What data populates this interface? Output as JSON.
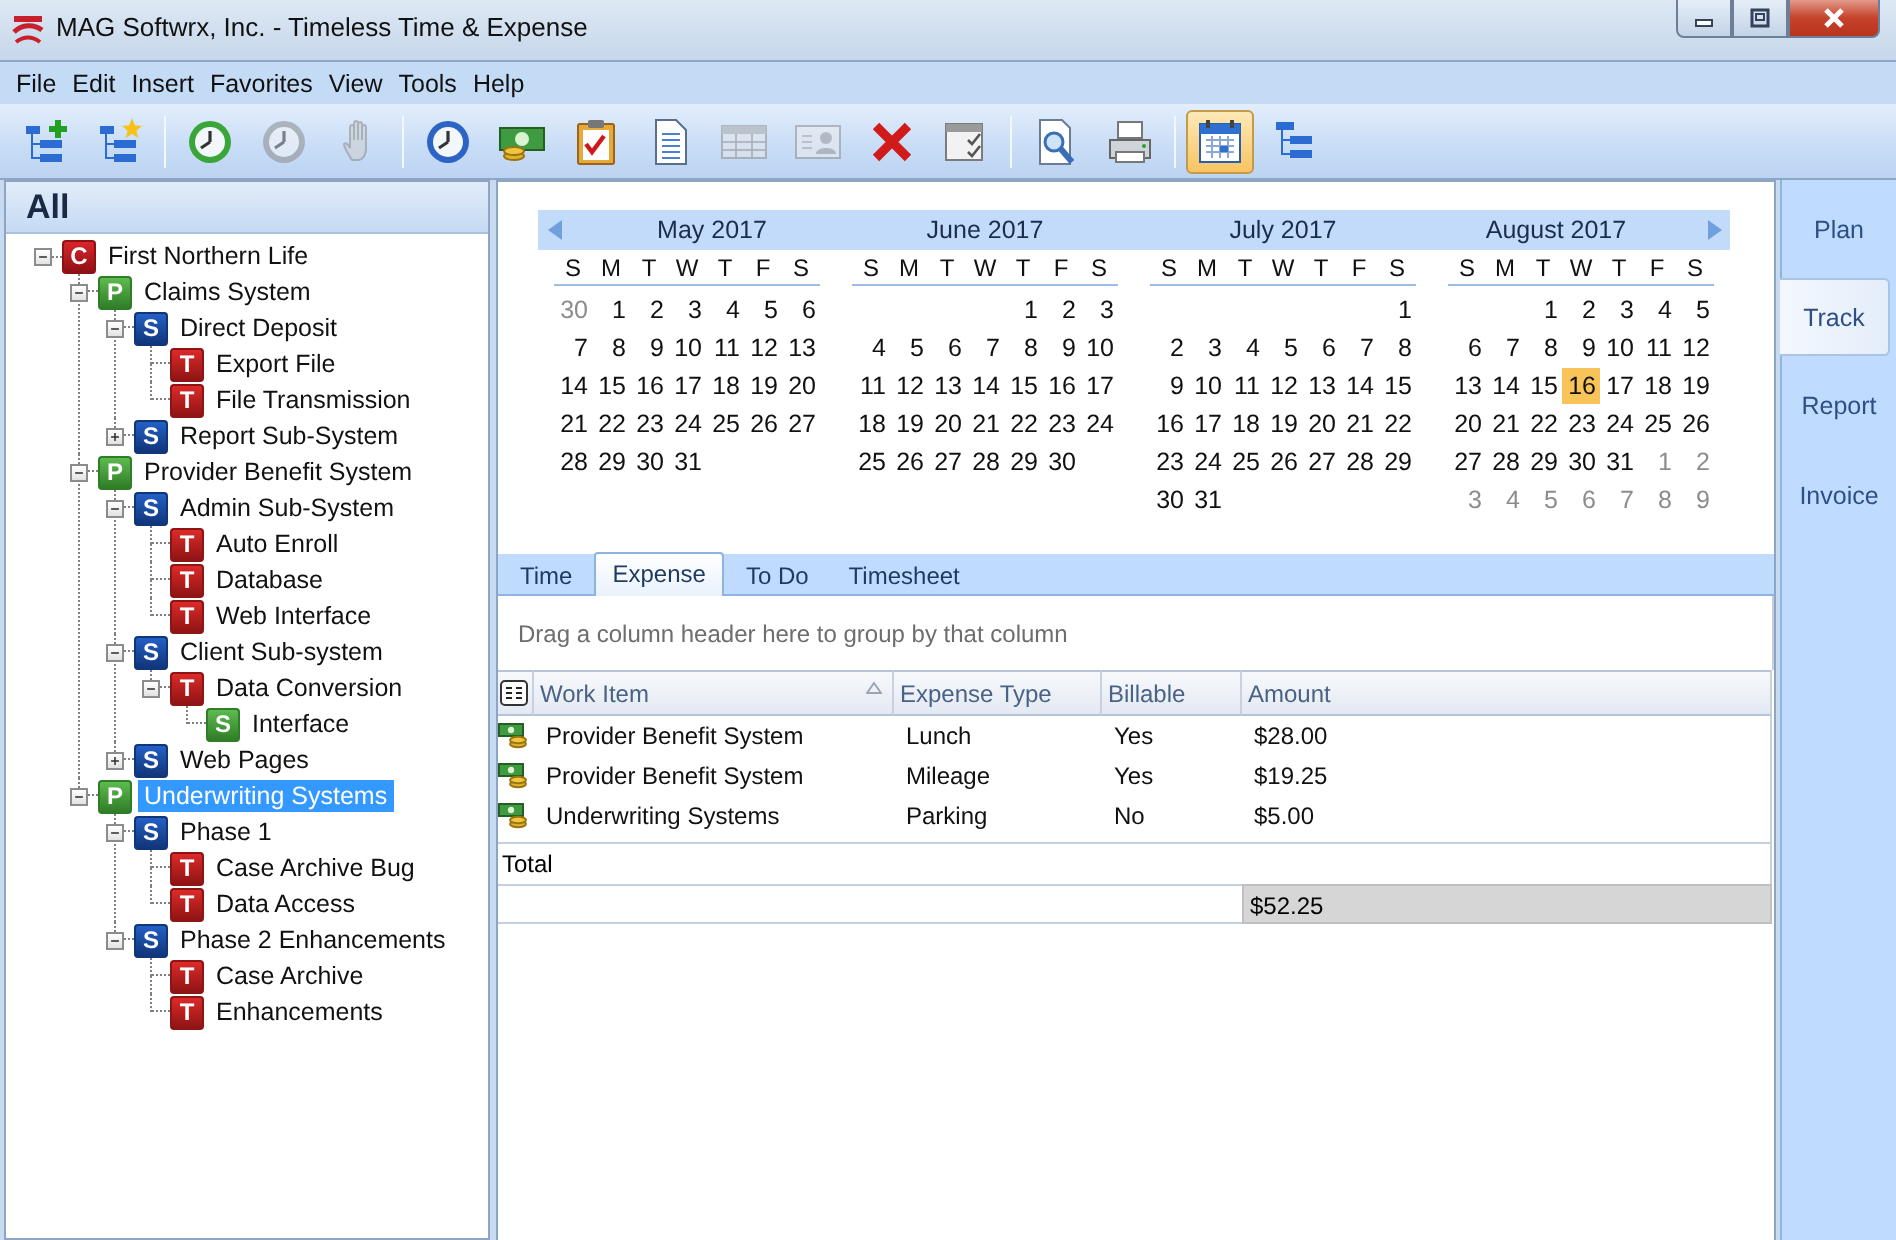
{
  "window": {
    "title": "MAG Softwrx, Inc. - Timeless Time & Expense"
  },
  "menu": [
    "File",
    "Edit",
    "Insert",
    "Favorites",
    "View",
    "Tools",
    "Help"
  ],
  "toolbar": [
    {
      "kind": "button",
      "disabled": false,
      "selected": false
    },
    {
      "kind": "button",
      "disabled": false,
      "selected": false
    },
    {
      "kind": "separator"
    },
    {
      "kind": "button",
      "disabled": false,
      "selected": false
    },
    {
      "kind": "button",
      "disabled": true,
      "selected": false
    },
    {
      "kind": "button",
      "disabled": true,
      "selected": false
    },
    {
      "kind": "separator"
    },
    {
      "kind": "button",
      "disabled": false,
      "selected": false
    },
    {
      "kind": "button",
      "disabled": false,
      "selected": false
    },
    {
      "kind": "button",
      "disabled": false,
      "selected": false
    },
    {
      "kind": "button",
      "disabled": false,
      "selected": false
    },
    {
      "kind": "button",
      "disabled": true,
      "selected": false
    },
    {
      "kind": "button",
      "disabled": true,
      "selected": false
    },
    {
      "kind": "button",
      "disabled": false,
      "selected": false
    },
    {
      "kind": "button",
      "disabled": false,
      "selected": false
    },
    {
      "kind": "separator"
    },
    {
      "kind": "button",
      "disabled": false,
      "selected": false
    },
    {
      "kind": "button",
      "disabled": false,
      "selected": false
    },
    {
      "kind": "separator"
    },
    {
      "kind": "button",
      "disabled": false,
      "selected": true
    },
    {
      "kind": "button",
      "disabled": false,
      "selected": false
    }
  ],
  "tree": {
    "header": "All",
    "nodes": [
      {
        "label": "First Northern Life",
        "badge": "C",
        "kind": "client",
        "expanded": true,
        "selected": false,
        "children": [
          {
            "label": "Claims System",
            "badge": "P",
            "kind": "project",
            "expanded": true,
            "selected": false,
            "children": [
              {
                "label": "Direct Deposit",
                "badge": "S",
                "kind": "system",
                "expanded": true,
                "selected": false,
                "children": [
                  {
                    "label": "Export File",
                    "badge": "T",
                    "kind": "task",
                    "selected": false
                  },
                  {
                    "label": "File Transmission",
                    "badge": "T",
                    "kind": "task",
                    "selected": false
                  }
                ]
              },
              {
                "label": "Report Sub-System",
                "badge": "S",
                "kind": "system",
                "expanded": false,
                "selected": false
              }
            ]
          },
          {
            "label": "Provider Benefit System",
            "badge": "P",
            "kind": "project",
            "expanded": true,
            "selected": false,
            "children": [
              {
                "label": "Admin Sub-System",
                "badge": "S",
                "kind": "system",
                "expanded": true,
                "selected": false,
                "children": [
                  {
                    "label": "Auto Enroll",
                    "badge": "T",
                    "kind": "task",
                    "selected": false
                  },
                  {
                    "label": "Database",
                    "badge": "T",
                    "kind": "task",
                    "selected": false
                  },
                  {
                    "label": "Web Interface",
                    "badge": "T",
                    "kind": "task",
                    "selected": false
                  }
                ]
              },
              {
                "label": "Client Sub-system",
                "badge": "S",
                "kind": "system",
                "expanded": true,
                "selected": false,
                "children": [
                  {
                    "label": "Data Conversion",
                    "badge": "T",
                    "kind": "task",
                    "expanded": true,
                    "selected": false,
                    "children": [
                      {
                        "label": "Interface",
                        "badge": "S",
                        "kind": "module",
                        "selected": false
                      }
                    ]
                  }
                ]
              },
              {
                "label": "Web Pages",
                "badge": "S",
                "kind": "system",
                "expanded": false,
                "selected": false
              }
            ]
          },
          {
            "label": "Underwriting Systems",
            "badge": "P",
            "kind": "project",
            "expanded": true,
            "selected": true,
            "children": [
              {
                "label": "Phase 1",
                "badge": "S",
                "kind": "system",
                "expanded": true,
                "selected": false,
                "children": [
                  {
                    "label": "Case Archive Bug",
                    "badge": "T",
                    "kind": "task",
                    "selected": false
                  },
                  {
                    "label": "Data Access",
                    "badge": "T",
                    "kind": "task",
                    "selected": false
                  }
                ]
              },
              {
                "label": "Phase 2 Enhancements",
                "badge": "S",
                "kind": "system",
                "expanded": true,
                "selected": false,
                "children": [
                  {
                    "label": "Case Archive",
                    "badge": "T",
                    "kind": "task",
                    "selected": false
                  },
                  {
                    "label": "Enhancements",
                    "badge": "T",
                    "kind": "task",
                    "selected": false
                  }
                ]
              }
            ]
          }
        ]
      }
    ]
  },
  "calendar": {
    "months": [
      {
        "title": "May 2017",
        "weekdays": [
          "S",
          "M",
          "T",
          "W",
          "T",
          "F",
          "S"
        ],
        "weeks": [
          [
            {
              "day": "30",
              "outside": true,
              "selected": false
            },
            {
              "day": "1",
              "outside": false,
              "selected": false
            },
            {
              "day": "2",
              "outside": false,
              "selected": false
            },
            {
              "day": "3",
              "outside": false,
              "selected": false
            },
            {
              "day": "4",
              "outside": false,
              "selected": false
            },
            {
              "day": "5",
              "outside": false,
              "selected": false
            },
            {
              "day": "6",
              "outside": false,
              "selected": false
            }
          ],
          [
            {
              "day": "7",
              "outside": false,
              "selected": false
            },
            {
              "day": "8",
              "outside": false,
              "selected": false
            },
            {
              "day": "9",
              "outside": false,
              "selected": false
            },
            {
              "day": "10",
              "outside": false,
              "selected": false
            },
            {
              "day": "11",
              "outside": false,
              "selected": false
            },
            {
              "day": "12",
              "outside": false,
              "selected": false
            },
            {
              "day": "13",
              "outside": false,
              "selected": false
            }
          ],
          [
            {
              "day": "14",
              "outside": false,
              "selected": false
            },
            {
              "day": "15",
              "outside": false,
              "selected": false
            },
            {
              "day": "16",
              "outside": false,
              "selected": false
            },
            {
              "day": "17",
              "outside": false,
              "selected": false
            },
            {
              "day": "18",
              "outside": false,
              "selected": false
            },
            {
              "day": "19",
              "outside": false,
              "selected": false
            },
            {
              "day": "20",
              "outside": false,
              "selected": false
            }
          ],
          [
            {
              "day": "21",
              "outside": false,
              "selected": false
            },
            {
              "day": "22",
              "outside": false,
              "selected": false
            },
            {
              "day": "23",
              "outside": false,
              "selected": false
            },
            {
              "day": "24",
              "outside": false,
              "selected": false
            },
            {
              "day": "25",
              "outside": false,
              "selected": false
            },
            {
              "day": "26",
              "outside": false,
              "selected": false
            },
            {
              "day": "27",
              "outside": false,
              "selected": false
            }
          ],
          [
            {
              "day": "28",
              "outside": false,
              "selected": false
            },
            {
              "day": "29",
              "outside": false,
              "selected": false
            },
            {
              "day": "30",
              "outside": false,
              "selected": false
            },
            {
              "day": "31",
              "outside": false,
              "selected": false
            }
          ]
        ]
      },
      {
        "title": "June 2017",
        "weekdays": [
          "S",
          "M",
          "T",
          "W",
          "T",
          "F",
          "S"
        ],
        "weeks": [
          [
            {
              "day": "1",
              "outside": false,
              "selected": false
            },
            {
              "day": "2",
              "outside": false,
              "selected": false
            },
            {
              "day": "3",
              "outside": false,
              "selected": false
            }
          ],
          [
            {
              "day": "4",
              "outside": false,
              "selected": false
            },
            {
              "day": "5",
              "outside": false,
              "selected": false
            },
            {
              "day": "6",
              "outside": false,
              "selected": false
            },
            {
              "day": "7",
              "outside": false,
              "selected": false
            },
            {
              "day": "8",
              "outside": false,
              "selected": false
            },
            {
              "day": "9",
              "outside": false,
              "selected": false
            },
            {
              "day": "10",
              "outside": false,
              "selected": false
            }
          ],
          [
            {
              "day": "11",
              "outside": false,
              "selected": false
            },
            {
              "day": "12",
              "outside": false,
              "selected": false
            },
            {
              "day": "13",
              "outside": false,
              "selected": false
            },
            {
              "day": "14",
              "outside": false,
              "selected": false
            },
            {
              "day": "15",
              "outside": false,
              "selected": false
            },
            {
              "day": "16",
              "outside": false,
              "selected": false
            },
            {
              "day": "17",
              "outside": false,
              "selected": false
            }
          ],
          [
            {
              "day": "18",
              "outside": false,
              "selected": false
            },
            {
              "day": "19",
              "outside": false,
              "selected": false
            },
            {
              "day": "20",
              "outside": false,
              "selected": false
            },
            {
              "day": "21",
              "outside": false,
              "selected": false
            },
            {
              "day": "22",
              "outside": false,
              "selected": false
            },
            {
              "day": "23",
              "outside": false,
              "selected": false
            },
            {
              "day": "24",
              "outside": false,
              "selected": false
            }
          ],
          [
            {
              "day": "25",
              "outside": false,
              "selected": false
            },
            {
              "day": "26",
              "outside": false,
              "selected": false
            },
            {
              "day": "27",
              "outside": false,
              "selected": false
            },
            {
              "day": "28",
              "outside": false,
              "selected": false
            },
            {
              "day": "29",
              "outside": false,
              "selected": false
            },
            {
              "day": "30",
              "outside": false,
              "selected": false
            }
          ]
        ]
      },
      {
        "title": "July 2017",
        "weekdays": [
          "S",
          "M",
          "T",
          "W",
          "T",
          "F",
          "S"
        ],
        "weeks": [
          [
            {
              "day": "1",
              "outside": false,
              "selected": false
            }
          ],
          [
            {
              "day": "2",
              "outside": false,
              "selected": false
            },
            {
              "day": "3",
              "outside": false,
              "selected": false
            },
            {
              "day": "4",
              "outside": false,
              "selected": false
            },
            {
              "day": "5",
              "outside": false,
              "selected": false
            },
            {
              "day": "6",
              "outside": false,
              "selected": false
            },
            {
              "day": "7",
              "outside": false,
              "selected": false
            },
            {
              "day": "8",
              "outside": false,
              "selected": false
            }
          ],
          [
            {
              "day": "9",
              "outside": false,
              "selected": false
            },
            {
              "day": "10",
              "outside": false,
              "selected": false
            },
            {
              "day": "11",
              "outside": false,
              "selected": false
            },
            {
              "day": "12",
              "outside": false,
              "selected": false
            },
            {
              "day": "13",
              "outside": false,
              "selected": false
            },
            {
              "day": "14",
              "outside": false,
              "selected": false
            },
            {
              "day": "15",
              "outside": false,
              "selected": false
            }
          ],
          [
            {
              "day": "16",
              "outside": false,
              "selected": false
            },
            {
              "day": "17",
              "outside": false,
              "selected": false
            },
            {
              "day": "18",
              "outside": false,
              "selected": false
            },
            {
              "day": "19",
              "outside": false,
              "selected": false
            },
            {
              "day": "20",
              "outside": false,
              "selected": false
            },
            {
              "day": "21",
              "outside": false,
              "selected": false
            },
            {
              "day": "22",
              "outside": false,
              "selected": false
            }
          ],
          [
            {
              "day": "23",
              "outside": false,
              "selected": false
            },
            {
              "day": "24",
              "outside": false,
              "selected": false
            },
            {
              "day": "25",
              "outside": false,
              "selected": false
            },
            {
              "day": "26",
              "outside": false,
              "selected": false
            },
            {
              "day": "27",
              "outside": false,
              "selected": false
            },
            {
              "day": "28",
              "outside": false,
              "selected": false
            },
            {
              "day": "29",
              "outside": false,
              "selected": false
            }
          ],
          [
            {
              "day": "30",
              "outside": false,
              "selected": false
            },
            {
              "day": "31",
              "outside": false,
              "selected": false
            }
          ]
        ]
      },
      {
        "title": "August 2017",
        "weekdays": [
          "S",
          "M",
          "T",
          "W",
          "T",
          "F",
          "S"
        ],
        "weeks": [
          [
            {
              "day": "1",
              "outside": false,
              "selected": false
            },
            {
              "day": "2",
              "outside": false,
              "selected": false
            },
            {
              "day": "3",
              "outside": false,
              "selected": false
            },
            {
              "day": "4",
              "outside": false,
              "selected": false
            },
            {
              "day": "5",
              "outside": false,
              "selected": false
            }
          ],
          [
            {
              "day": "6",
              "outside": false,
              "selected": false
            },
            {
              "day": "7",
              "outside": false,
              "selected": false
            },
            {
              "day": "8",
              "outside": false,
              "selected": false
            },
            {
              "day": "9",
              "outside": false,
              "selected": false
            },
            {
              "day": "10",
              "outside": false,
              "selected": false
            },
            {
              "day": "11",
              "outside": false,
              "selected": false
            },
            {
              "day": "12",
              "outside": false,
              "selected": false
            }
          ],
          [
            {
              "day": "13",
              "outside": false,
              "selected": false
            },
            {
              "day": "14",
              "outside": false,
              "selected": false
            },
            {
              "day": "15",
              "outside": false,
              "selected": false
            },
            {
              "day": "16",
              "outside": false,
              "selected": true
            },
            {
              "day": "17",
              "outside": false,
              "selected": false
            },
            {
              "day": "18",
              "outside": false,
              "selected": false
            },
            {
              "day": "19",
              "outside": false,
              "selected": false
            }
          ],
          [
            {
              "day": "20",
              "outside": false,
              "selected": false
            },
            {
              "day": "21",
              "outside": false,
              "selected": false
            },
            {
              "day": "22",
              "outside": false,
              "selected": false
            },
            {
              "day": "23",
              "outside": false,
              "selected": false
            },
            {
              "day": "24",
              "outside": false,
              "selected": false
            },
            {
              "day": "25",
              "outside": false,
              "selected": false
            },
            {
              "day": "26",
              "outside": false,
              "selected": false
            }
          ],
          [
            {
              "day": "27",
              "outside": false,
              "selected": false
            },
            {
              "day": "28",
              "outside": false,
              "selected": false
            },
            {
              "day": "29",
              "outside": false,
              "selected": false
            },
            {
              "day": "30",
              "outside": false,
              "selected": false
            },
            {
              "day": "31",
              "outside": false,
              "selected": false
            },
            {
              "day": "1",
              "outside": true,
              "selected": false
            },
            {
              "day": "2",
              "outside": true,
              "selected": false
            }
          ],
          [
            {
              "day": "3",
              "outside": true,
              "selected": false
            },
            {
              "day": "4",
              "outside": true,
              "selected": false
            },
            {
              "day": "5",
              "outside": true,
              "selected": false
            },
            {
              "day": "6",
              "outside": true,
              "selected": false
            },
            {
              "day": "7",
              "outside": true,
              "selected": false
            },
            {
              "day": "8",
              "outside": true,
              "selected": false
            },
            {
              "day": "9",
              "outside": true,
              "selected": false
            }
          ]
        ]
      }
    ]
  },
  "tabs": [
    {
      "label": "Time",
      "selected": false
    },
    {
      "label": "Expense",
      "selected": true
    },
    {
      "label": "To Do",
      "selected": false
    },
    {
      "label": "Timesheet",
      "selected": false
    }
  ],
  "expenses": {
    "group_hint": "Drag a column header here to group by that column",
    "columns": [
      {
        "label": "Work Item",
        "sorted": true
      },
      {
        "label": "Expense Type",
        "sorted": false
      },
      {
        "label": "Billable",
        "sorted": false
      },
      {
        "label": "Amount",
        "sorted": false
      }
    ],
    "rows": [
      {
        "cells": [
          "Provider Benefit System",
          "Lunch",
          "Yes",
          "$28.00"
        ]
      },
      {
        "cells": [
          "Provider Benefit System",
          "Mileage",
          "Yes",
          "$19.25"
        ]
      },
      {
        "cells": [
          "Underwriting Systems",
          "Parking",
          "No",
          "$5.00"
        ]
      }
    ],
    "total_label": "Total",
    "total_amount": "$52.25"
  },
  "side_tabs": [
    {
      "label": "Plan",
      "selected": false
    },
    {
      "label": "Track",
      "selected": true
    },
    {
      "label": "Report",
      "selected": false
    },
    {
      "label": "Invoice",
      "selected": false
    }
  ]
}
